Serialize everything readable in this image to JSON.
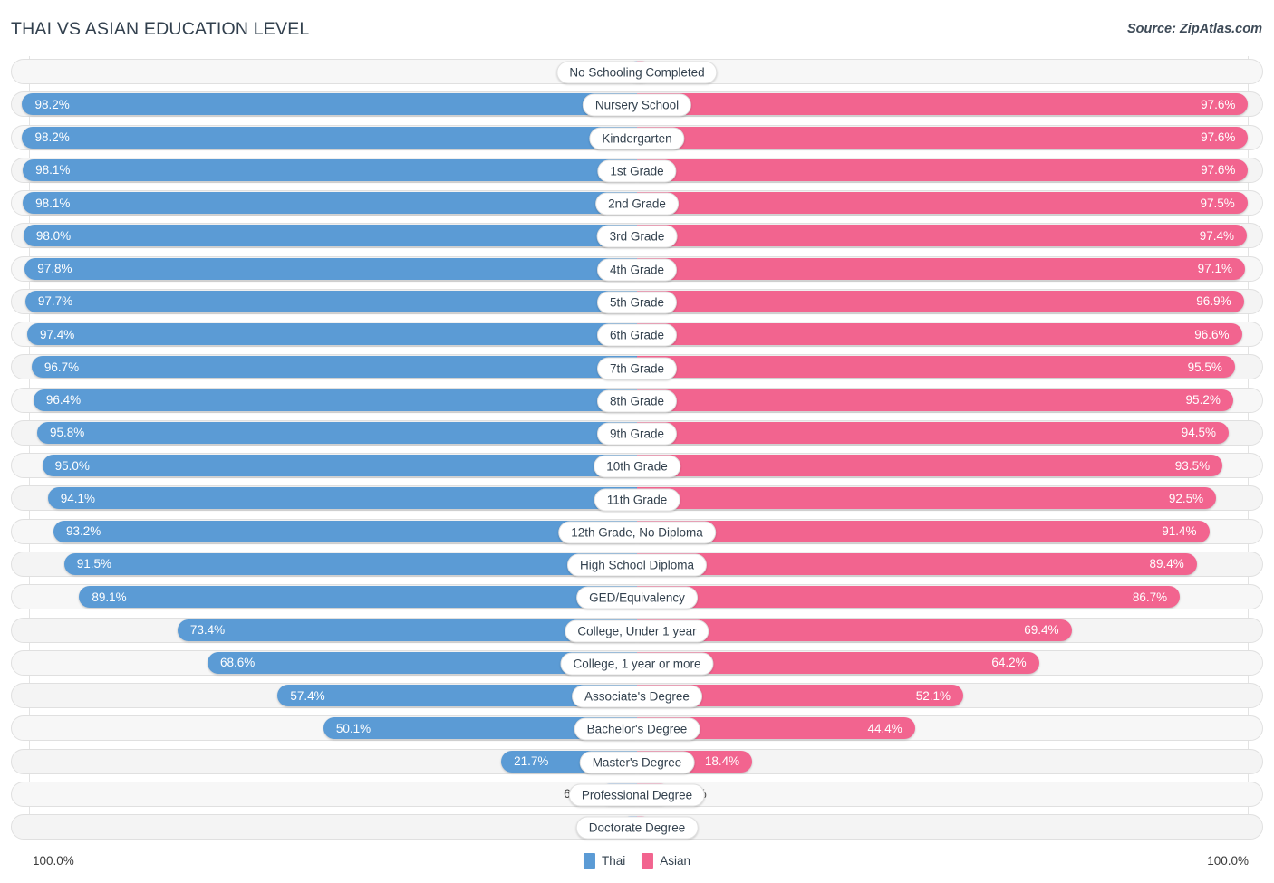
{
  "header": {
    "title": "THAI VS ASIAN EDUCATION LEVEL",
    "source": "Source: ZipAtlas.com"
  },
  "footer": {
    "axis_left": "100.0%",
    "axis_right": "100.0%",
    "legend": [
      {
        "label": "Thai",
        "color": "#5b9bd5"
      },
      {
        "label": "Asian",
        "color": "#f2648f"
      }
    ]
  },
  "colors": {
    "thai": "#5b9bd5",
    "asian": "#f2648f",
    "thai_pale": "#a8c6e8",
    "asian_pale": "#f5a3c0",
    "track": "#f4f4f4",
    "title": "#32404e"
  },
  "chart_data": {
    "type": "bar",
    "title": "THAI VS ASIAN EDUCATION LEVEL",
    "subtitle": "Source: ZipAtlas.com",
    "orientation": "horizontal-diverging",
    "xlabel": "",
    "ylabel": "",
    "xlim": [
      0,
      100
    ],
    "axis_left_max": "100.0%",
    "axis_right_max": "100.0%",
    "grid": true,
    "legend_position": "bottom-center",
    "categories": [
      "No Schooling Completed",
      "Nursery School",
      "Kindergarten",
      "1st Grade",
      "2nd Grade",
      "3rd Grade",
      "4th Grade",
      "5th Grade",
      "6th Grade",
      "7th Grade",
      "8th Grade",
      "9th Grade",
      "10th Grade",
      "11th Grade",
      "12th Grade, No Diploma",
      "High School Diploma",
      "GED/Equivalency",
      "College, Under 1 year",
      "College, 1 year or more",
      "Associate's Degree",
      "Bachelor's Degree",
      "Master's Degree",
      "Professional Degree",
      "Doctorate Degree"
    ],
    "series": [
      {
        "name": "Thai",
        "color": "#5b9bd5",
        "values": [
          1.8,
          98.2,
          98.2,
          98.1,
          98.1,
          98.0,
          97.8,
          97.7,
          97.4,
          96.7,
          96.4,
          95.8,
          95.0,
          94.1,
          93.2,
          91.5,
          89.1,
          73.4,
          68.6,
          57.4,
          50.1,
          21.7,
          6.1,
          2.8
        ]
      },
      {
        "name": "Asian",
        "color": "#f2648f",
        "values": [
          2.4,
          97.6,
          97.6,
          97.6,
          97.5,
          97.4,
          97.1,
          96.9,
          96.6,
          95.5,
          95.2,
          94.5,
          93.5,
          92.5,
          91.4,
          89.4,
          86.7,
          69.4,
          64.2,
          52.1,
          44.4,
          18.4,
          5.5,
          2.4
        ]
      }
    ]
  },
  "rows": [
    {
      "label": "No Schooling Completed",
      "left": "1.8%",
      "right": "2.4%",
      "left_val": 1.8,
      "right_val": 2.4
    },
    {
      "label": "Nursery School",
      "left": "98.2%",
      "right": "97.6%",
      "left_val": 98.2,
      "right_val": 97.6
    },
    {
      "label": "Kindergarten",
      "left": "98.2%",
      "right": "97.6%",
      "left_val": 98.2,
      "right_val": 97.6
    },
    {
      "label": "1st Grade",
      "left": "98.1%",
      "right": "97.6%",
      "left_val": 98.1,
      "right_val": 97.6
    },
    {
      "label": "2nd Grade",
      "left": "98.1%",
      "right": "97.5%",
      "left_val": 98.1,
      "right_val": 97.5
    },
    {
      "label": "3rd Grade",
      "left": "98.0%",
      "right": "97.4%",
      "left_val": 98.0,
      "right_val": 97.4
    },
    {
      "label": "4th Grade",
      "left": "97.8%",
      "right": "97.1%",
      "left_val": 97.8,
      "right_val": 97.1
    },
    {
      "label": "5th Grade",
      "left": "97.7%",
      "right": "96.9%",
      "left_val": 97.7,
      "right_val": 96.9
    },
    {
      "label": "6th Grade",
      "left": "97.4%",
      "right": "96.6%",
      "left_val": 97.4,
      "right_val": 96.6
    },
    {
      "label": "7th Grade",
      "left": "96.7%",
      "right": "95.5%",
      "left_val": 96.7,
      "right_val": 95.5
    },
    {
      "label": "8th Grade",
      "left": "96.4%",
      "right": "95.2%",
      "left_val": 96.4,
      "right_val": 95.2
    },
    {
      "label": "9th Grade",
      "left": "95.8%",
      "right": "94.5%",
      "left_val": 95.8,
      "right_val": 94.5
    },
    {
      "label": "10th Grade",
      "left": "95.0%",
      "right": "93.5%",
      "left_val": 95.0,
      "right_val": 93.5
    },
    {
      "label": "11th Grade",
      "left": "94.1%",
      "right": "92.5%",
      "left_val": 94.1,
      "right_val": 92.5
    },
    {
      "label": "12th Grade, No Diploma",
      "left": "93.2%",
      "right": "91.4%",
      "left_val": 93.2,
      "right_val": 91.4
    },
    {
      "label": "High School Diploma",
      "left": "91.5%",
      "right": "89.4%",
      "left_val": 91.5,
      "right_val": 89.4
    },
    {
      "label": "GED/Equivalency",
      "left": "89.1%",
      "right": "86.7%",
      "left_val": 89.1,
      "right_val": 86.7
    },
    {
      "label": "College, Under 1 year",
      "left": "73.4%",
      "right": "69.4%",
      "left_val": 73.4,
      "right_val": 69.4
    },
    {
      "label": "College, 1 year or more",
      "left": "68.6%",
      "right": "64.2%",
      "left_val": 68.6,
      "right_val": 64.2
    },
    {
      "label": "Associate's Degree",
      "left": "57.4%",
      "right": "52.1%",
      "left_val": 57.4,
      "right_val": 52.1
    },
    {
      "label": "Bachelor's Degree",
      "left": "50.1%",
      "right": "44.4%",
      "left_val": 50.1,
      "right_val": 44.4
    },
    {
      "label": "Master's Degree",
      "left": "21.7%",
      "right": "18.4%",
      "left_val": 21.7,
      "right_val": 18.4
    },
    {
      "label": "Professional Degree",
      "left": "6.1%",
      "right": "5.5%",
      "left_val": 6.1,
      "right_val": 5.5
    },
    {
      "label": "Doctorate Degree",
      "left": "2.8%",
      "right": "2.4%",
      "left_val": 2.8,
      "right_val": 2.4
    }
  ]
}
